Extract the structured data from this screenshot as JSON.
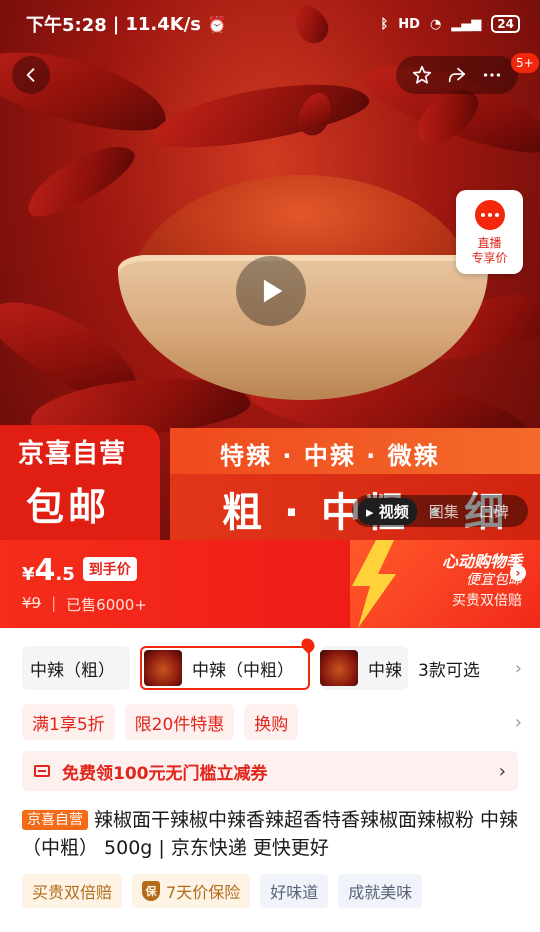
{
  "status": {
    "time": "下午5:28",
    "speed": "11.4K/s",
    "network": "HD",
    "battery": "24"
  },
  "hero": {
    "live": {
      "line1": "直播",
      "line2": "专享价"
    },
    "badge_count": "5+",
    "jx": {
      "title": "京喜自营",
      "big": "包邮"
    },
    "spice_levels": "特辣 · 中辣 · 微辣",
    "grind_levels": "粗 · 中粗 · 细",
    "media_tabs": [
      "视频",
      "图集",
      "口碑"
    ]
  },
  "price": {
    "symbol": "¥",
    "int": "4",
    "dec": ".5",
    "tag": "到手价",
    "original": "¥9",
    "sold": "已售6000+",
    "promo_line1": "心动购物季",
    "promo_line2": "便宜包邮",
    "promo_line3": "买贵双倍赔"
  },
  "variants": {
    "items": [
      "中辣（粗）",
      "中辣（中粗）",
      "中辣"
    ],
    "count": "3款可选"
  },
  "chips": [
    "满1享5折",
    "限20件特惠",
    "换购"
  ],
  "coupon": {
    "text": "免费领100元无门槛立减券"
  },
  "product": {
    "badge": "京喜自营",
    "title": "辣椒面干辣椒中辣香辣超香特香辣椒面辣椒粉 中辣（中粗） 500g | 京东快递 更快更好"
  },
  "tags": [
    {
      "text": "买贵双倍赔"
    },
    {
      "icon_text": "保",
      "text": "7天价保险"
    },
    {
      "text": "好味道"
    },
    {
      "text": "成就美味"
    }
  ],
  "colors": {
    "accent": "#f2270c",
    "brand_red": "#e1251b",
    "orange": "#f46a17"
  }
}
